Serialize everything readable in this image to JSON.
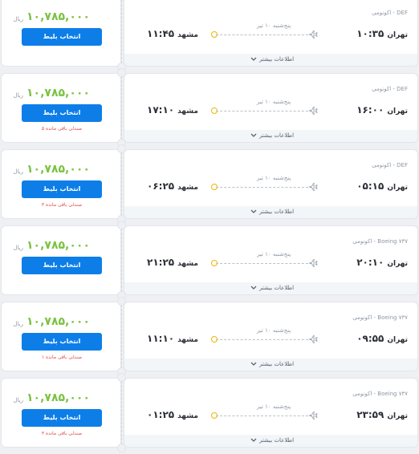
{
  "labels": {
    "currency": "ریال",
    "buy_button": "انتخاب بلیط",
    "more_info": "اطلاعات بیشتر"
  },
  "flights": [
    {
      "price": "۱۰,۷۸۵,۰۰۰",
      "seats": "",
      "type": "DEF - اکونومی",
      "origin": "تهران",
      "dep_time": "۱۰:۳۵",
      "dest": "مشهد",
      "arr_time": "۱۱:۴۵",
      "date": "پنج‌شنبه ۱۰ تیر"
    },
    {
      "price": "۱۰,۷۸۵,۰۰۰",
      "seats": "۵ صندلی باقی مانده",
      "type": "DEF - اکونومی",
      "origin": "تهران",
      "dep_time": "۱۶:۰۰",
      "dest": "مشهد",
      "arr_time": "۱۷:۱۰",
      "date": "پنج‌شنبه ۱۰ تیر"
    },
    {
      "price": "۱۰,۷۸۵,۰۰۰",
      "seats": "۳ صندلی باقی مانده",
      "type": "DEF - اکونومی",
      "origin": "تهران",
      "dep_time": "۰۵:۱۵",
      "dest": "مشهد",
      "arr_time": "۰۶:۲۵",
      "date": "پنج‌شنبه ۱۰ تیر"
    },
    {
      "price": "۱۰,۷۸۵,۰۰۰",
      "seats": "",
      "type": "Boeing ۷۳۷ - اکونومی",
      "origin": "تهران",
      "dep_time": "۲۰:۱۰",
      "dest": "مشهد",
      "arr_time": "۲۱:۲۵",
      "date": "پنج‌شنبه ۱۰ تیر"
    },
    {
      "price": "۱۰,۷۸۵,۰۰۰",
      "seats": "۱ صندلی باقی مانده",
      "type": "Boeing ۷۳۷ - اکونومی",
      "origin": "تهران",
      "dep_time": "۰۹:۵۵",
      "dest": "مشهد",
      "arr_time": "۱۱:۱۰",
      "date": "پنج‌شنبه ۱۰ تیر"
    },
    {
      "price": "۱۰,۷۸۵,۰۰۰",
      "seats": "۳ صندلی باقی مانده",
      "type": "Boeing ۷۳۷ - اکونومی",
      "origin": "تهران",
      "dep_time": "۲۳:۵۹",
      "dest": "مشهد",
      "arr_time": "۰۱:۲۵",
      "date": "پنج‌شنبه ۱۰ تیر"
    }
  ],
  "colors": {
    "price": "#7cc243",
    "button": "#0d7ee8",
    "seats_warning": "#e04747",
    "origin_dot": "#f2b500"
  },
  "icons": [
    "airplane-icon",
    "origin-dot-icon",
    "chevron-down-icon"
  ]
}
